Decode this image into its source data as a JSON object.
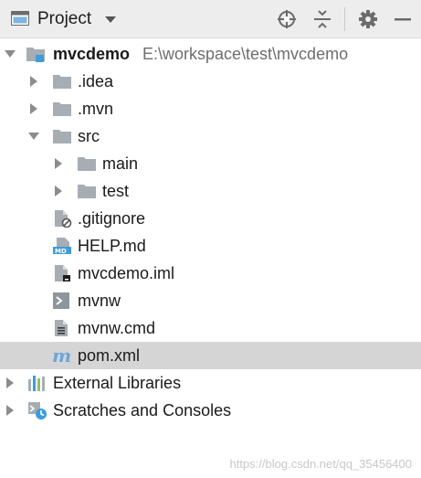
{
  "header": {
    "title": "Project"
  },
  "tree": {
    "root": {
      "name": "mvcdemo",
      "path": "E:\\workspace\\test\\mvcdemo"
    },
    "items": {
      "idea": ".idea",
      "mvn": ".mvn",
      "src": "src",
      "main": "main",
      "test": "test",
      "gitignore": ".gitignore",
      "help": "HELP.md",
      "iml": "mvcdemo.iml",
      "mvnw": "mvnw",
      "mvnw_cmd": "mvnw.cmd",
      "pom": "pom.xml",
      "external_libraries": "External Libraries",
      "scratches": "Scratches and Consoles"
    }
  },
  "watermark": "https://blog.csdn.net/qq_35456400",
  "colors": {
    "folder": "#a6adb3",
    "selected_row": "#d5d5d5",
    "header_bg": "#ededed",
    "maven_blue": "#6aa6dc",
    "module_blue": "#3f9bdc"
  }
}
